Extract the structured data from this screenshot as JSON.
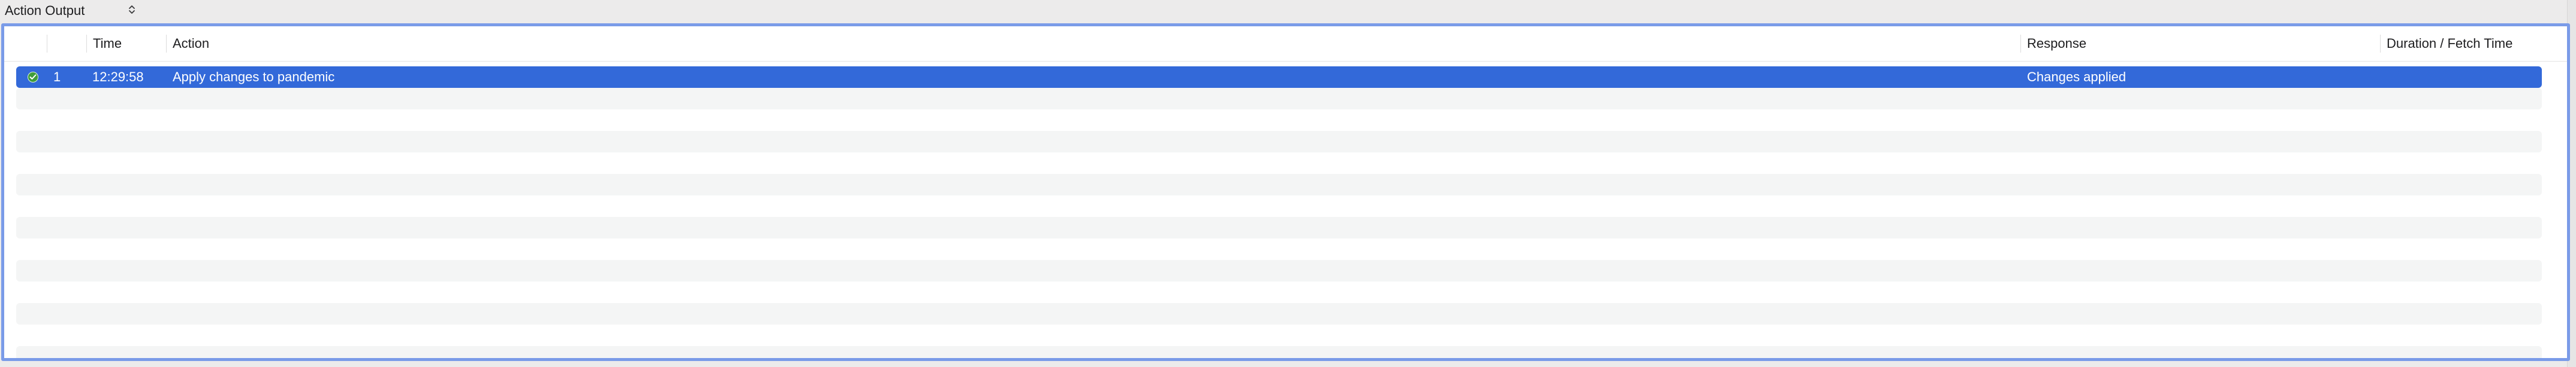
{
  "toolbar": {
    "selector_label": "Action Output",
    "selector_chevron": "⌃⌄"
  },
  "table": {
    "columns": {
      "status": "",
      "index": "",
      "time": "Time",
      "action": "Action",
      "response": "Response",
      "duration": "Duration / Fetch Time"
    },
    "rows": [
      {
        "status_icon": "success-check-icon",
        "index": "1",
        "time": "12:29:58",
        "action": "Apply changes to pandemic",
        "response": "Changes applied",
        "duration": ""
      }
    ]
  },
  "colors": {
    "selection": "#3369d9",
    "focus_border": "#7a9be8",
    "success": "#3f9d3a",
    "stripe": "#f4f5f5"
  }
}
